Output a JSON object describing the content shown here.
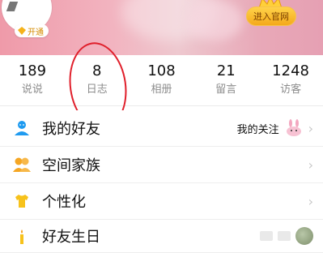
{
  "header": {
    "open_label": "开通",
    "enter_site_label": "进入官网"
  },
  "stats": [
    {
      "num": "189",
      "label": "说说"
    },
    {
      "num": "8",
      "label": "日志"
    },
    {
      "num": "108",
      "label": "相册"
    },
    {
      "num": "21",
      "label": "留言"
    },
    {
      "num": "1248",
      "label": "访客"
    }
  ],
  "menu": {
    "friends": {
      "label": "我的好友",
      "right_label": "我的关注",
      "chevron": "›"
    },
    "family": {
      "label": "空间家族",
      "chevron": "›"
    },
    "personalize": {
      "label": "个性化",
      "chevron": "›"
    },
    "partial": {
      "label": "好友生日"
    }
  },
  "colors": {
    "header_start": "#ef9aa9",
    "accent_gold": "#f4a91a",
    "annotation_red": "#e01f2b",
    "friend_icon": "#1f9bf0",
    "family_icon": "#f5a623",
    "personalize_icon": "#f7c21b"
  },
  "icons": {
    "open": "diamond-icon",
    "enter_site": "crown-icon",
    "friends": "user-icon",
    "family": "group-icon",
    "personalize": "tshirt-icon",
    "follow": "bunny-icon"
  }
}
